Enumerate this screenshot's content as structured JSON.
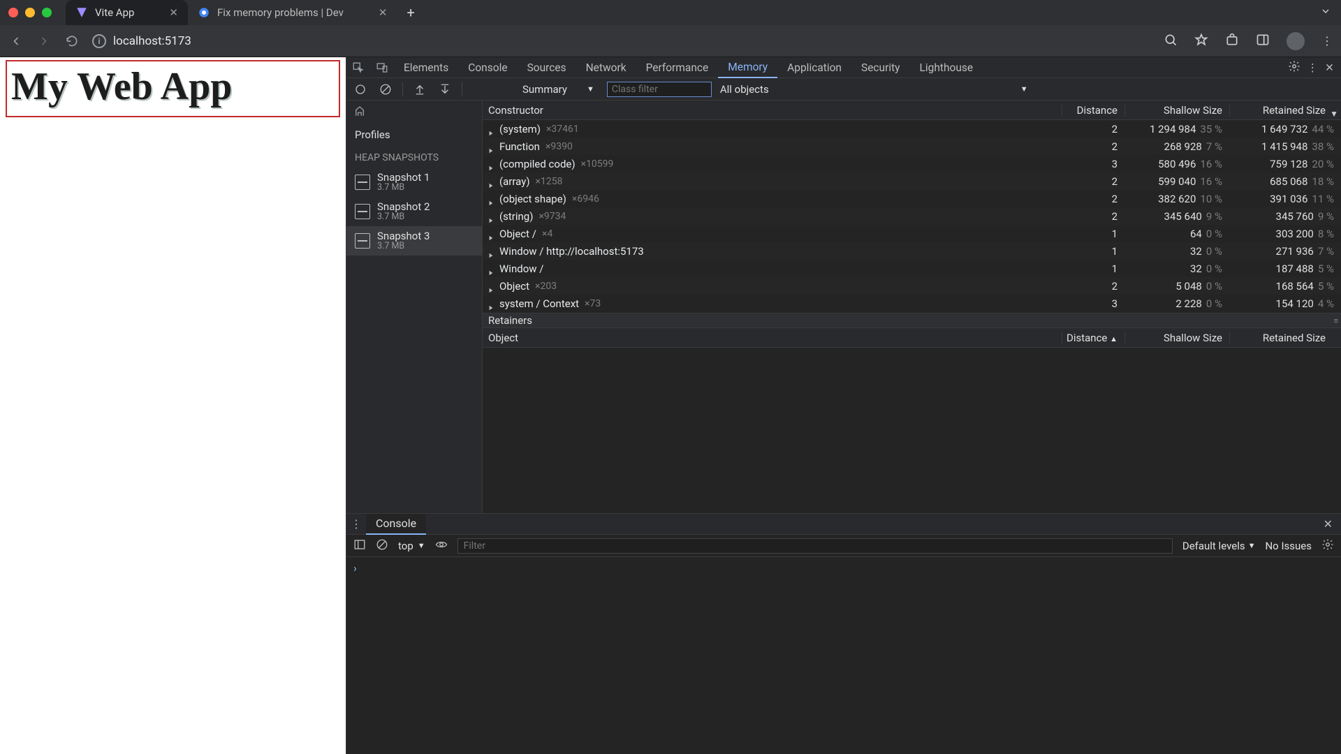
{
  "browser": {
    "tabs": [
      {
        "title": "Vite App",
        "active": true
      },
      {
        "title": "Fix memory problems  |  Dev",
        "active": false
      }
    ],
    "url": "localhost:5173"
  },
  "page": {
    "heading": "My Web App"
  },
  "devtools": {
    "tabs": [
      "Elements",
      "Console",
      "Sources",
      "Network",
      "Performance",
      "Memory",
      "Application",
      "Security",
      "Lighthouse"
    ],
    "active_tab": "Memory",
    "memory": {
      "view_mode": "Summary",
      "class_filter_placeholder": "Class filter",
      "object_filter": "All objects",
      "profiles_label": "Profiles",
      "heap_section_label": "HEAP SNAPSHOTS",
      "snapshots": [
        {
          "name": "Snapshot 1",
          "size": "3.7 MB",
          "selected": false
        },
        {
          "name": "Snapshot 2",
          "size": "3.7 MB",
          "selected": false
        },
        {
          "name": "Snapshot 3",
          "size": "3.7 MB",
          "selected": true
        }
      ],
      "columns": {
        "constructor": "Constructor",
        "distance": "Distance",
        "shallow": "Shallow Size",
        "retained": "Retained Size"
      },
      "rows": [
        {
          "name": "(system)",
          "count": "×37461",
          "dist": "2",
          "shallow": "1 294 984",
          "shallow_pct": "35 %",
          "ret": "1 649 732",
          "ret_pct": "44 %"
        },
        {
          "name": "Function",
          "count": "×9390",
          "dist": "2",
          "shallow": "268 928",
          "shallow_pct": "7 %",
          "ret": "1 415 948",
          "ret_pct": "38 %"
        },
        {
          "name": "(compiled code)",
          "count": "×10599",
          "dist": "3",
          "shallow": "580 496",
          "shallow_pct": "16 %",
          "ret": "759 128",
          "ret_pct": "20 %"
        },
        {
          "name": "(array)",
          "count": "×1258",
          "dist": "2",
          "shallow": "599 040",
          "shallow_pct": "16 %",
          "ret": "685 068",
          "ret_pct": "18 %"
        },
        {
          "name": "(object shape)",
          "count": "×6946",
          "dist": "2",
          "shallow": "382 620",
          "shallow_pct": "10 %",
          "ret": "391 036",
          "ret_pct": "11 %"
        },
        {
          "name": "(string)",
          "count": "×9734",
          "dist": "2",
          "shallow": "345 640",
          "shallow_pct": "9 %",
          "ret": "345 760",
          "ret_pct": "9 %"
        },
        {
          "name": "Object /",
          "count": "×4",
          "dist": "1",
          "shallow": "64",
          "shallow_pct": "0 %",
          "ret": "303 200",
          "ret_pct": "8 %"
        },
        {
          "name": "Window / http://localhost:5173",
          "count": "",
          "dist": "1",
          "shallow": "32",
          "shallow_pct": "0 %",
          "ret": "271 936",
          "ret_pct": "7 %"
        },
        {
          "name": "Window /",
          "count": "",
          "dist": "1",
          "shallow": "32",
          "shallow_pct": "0 %",
          "ret": "187 488",
          "ret_pct": "5 %"
        },
        {
          "name": "Object",
          "count": "×203",
          "dist": "2",
          "shallow": "5 048",
          "shallow_pct": "0 %",
          "ret": "168 564",
          "ret_pct": "5 %"
        },
        {
          "name": "system / Context",
          "count": "×73",
          "dist": "3",
          "shallow": "2 228",
          "shallow_pct": "0 %",
          "ret": "154 120",
          "ret_pct": "4 %"
        }
      ],
      "retainers_label": "Retainers",
      "retainers_columns": {
        "object": "Object",
        "distance": "Distance",
        "shallow": "Shallow Size",
        "retained": "Retained Size"
      }
    },
    "console": {
      "tab_label": "Console",
      "context": "top",
      "filter_placeholder": "Filter",
      "levels_label": "Default levels",
      "issues_label": "No Issues"
    }
  }
}
